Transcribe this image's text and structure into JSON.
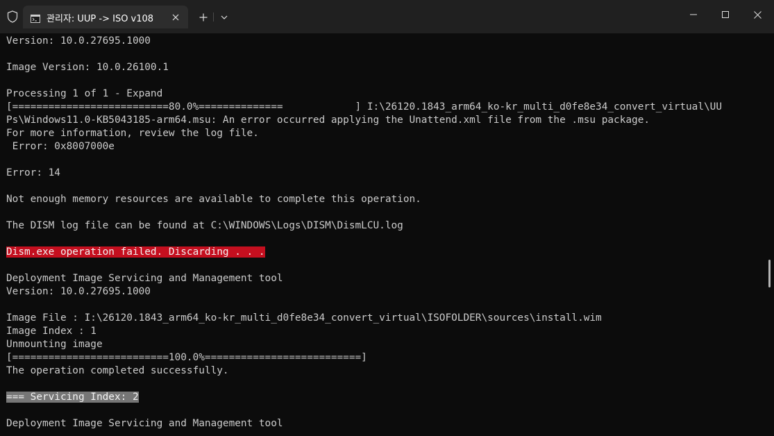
{
  "window": {
    "tab_title": "관리자:  UUP -> ISO v108",
    "icons": {
      "shield": "shield-icon",
      "tab": "terminal-icon",
      "tab_close": "close-icon",
      "new_tab": "plus-icon",
      "dropdown": "chevron-down-icon",
      "minimize": "minimize-icon",
      "maximize": "maximize-icon",
      "close": "close-icon"
    }
  },
  "colors": {
    "background": "#0c0c0c",
    "titlebar": "#202020",
    "tab": "#2d2d2d",
    "text": "#cccccc",
    "error_highlight": "#c50f1f",
    "selection_highlight": "#767676"
  },
  "terminal": {
    "lines": [
      "Version: 10.0.27695.1000",
      "",
      "Image Version: 10.0.26100.1",
      "",
      "Processing 1 of 1 - Expand",
      "[==========================80.0%==============            ] I:\\26120.1843_arm64_ko-kr_multi_d0fe8e34_convert_virtual\\UU",
      "Ps\\Windows11.0-KB5043185-arm64.msu: An error occurred applying the Unattend.xml file from the .msu package.",
      "For more information, review the log file.",
      " Error: 0x8007000e",
      "",
      "Error: 14",
      "",
      "Not enough memory resources are available to complete this operation.",
      "",
      "The DISM log file can be found at C:\\WINDOWS\\Logs\\DISM\\DismLCU.log",
      "",
      "Dism.exe operation failed. Discarding . . .",
      "",
      "Deployment Image Servicing and Management tool",
      "Version: 10.0.27695.1000",
      "",
      "Image File : I:\\26120.1843_arm64_ko-kr_multi_d0fe8e34_convert_virtual\\ISOFOLDER\\sources\\install.wim",
      "Image Index : 1",
      "Unmounting image",
      "[==========================100.0%==========================]",
      "The operation completed successfully.",
      "",
      "=== Servicing Index: 2",
      "",
      "Deployment Image Servicing and Management tool"
    ]
  }
}
